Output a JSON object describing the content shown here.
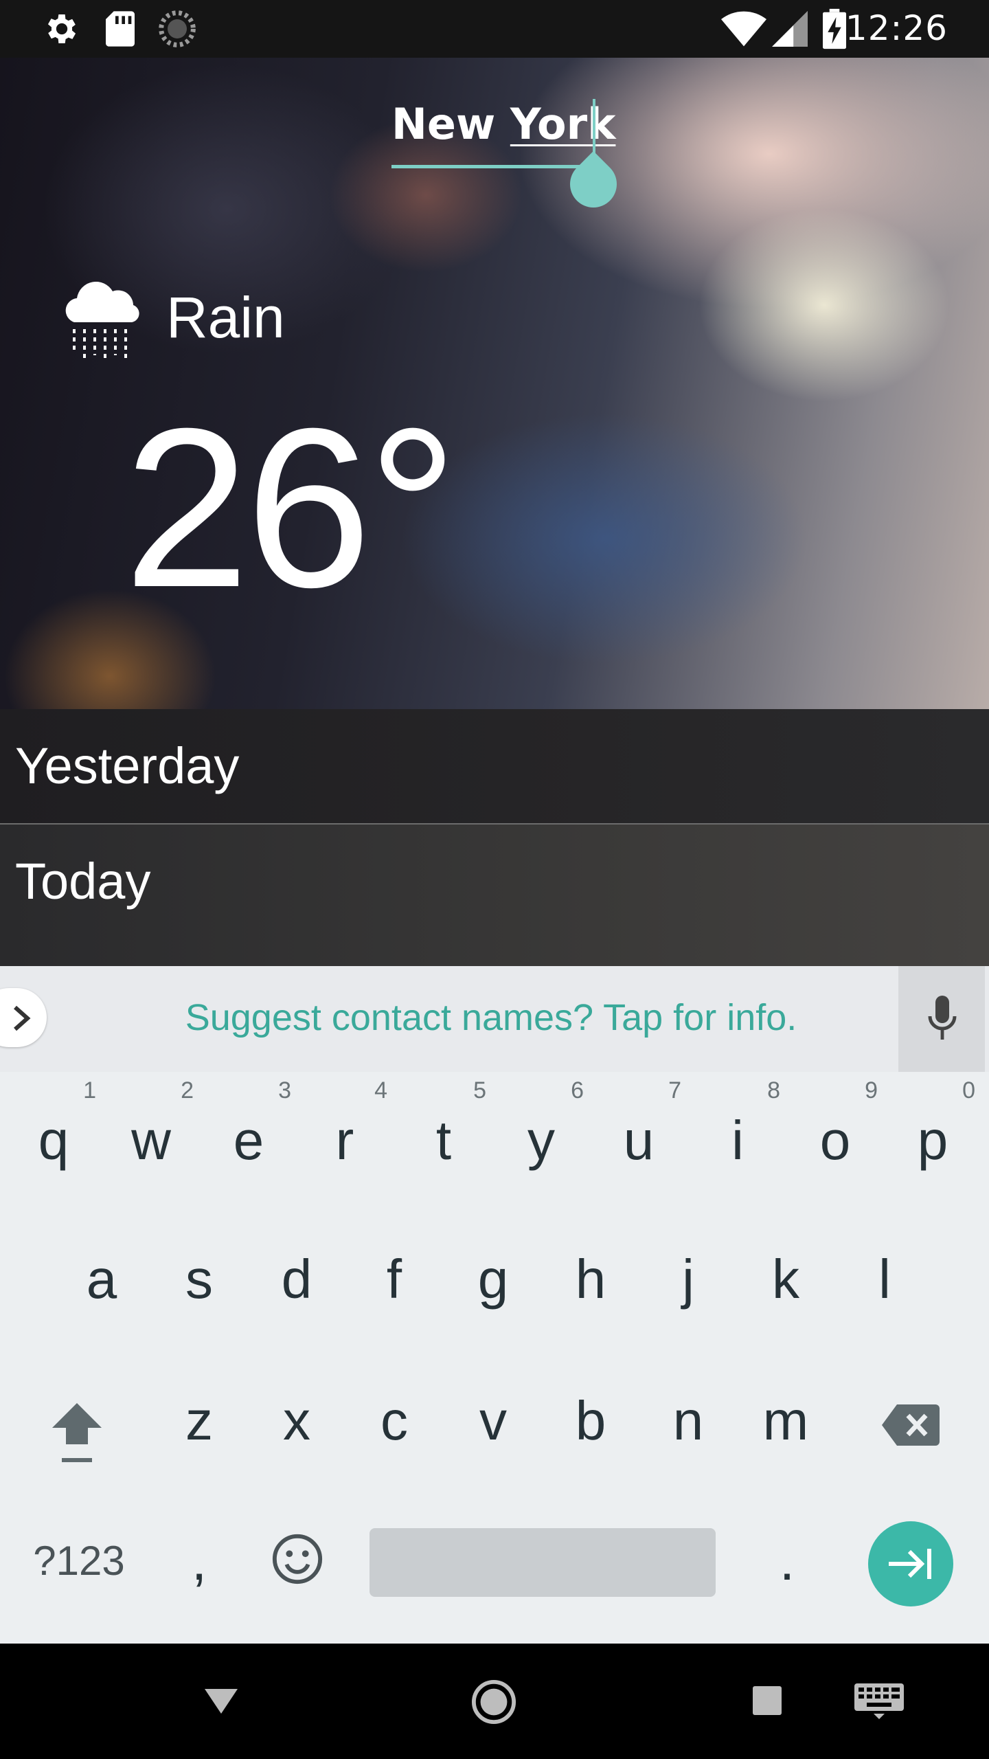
{
  "status_bar": {
    "time": "12:26",
    "left_icons": [
      "settings-icon",
      "sd-card-icon",
      "sync-icon"
    ],
    "right_icons": [
      "wifi-icon",
      "cell-signal-icon",
      "battery-charging-icon"
    ]
  },
  "weather": {
    "city_word_1": "New",
    "city_word_2": "York",
    "condition": "Rain",
    "condition_icon": "rain-cloud-icon",
    "temperature": "26°",
    "accent_color": "#7ecfc6"
  },
  "list": {
    "yesterday": "Yesterday",
    "today": "Today"
  },
  "suggestion": {
    "text": "Suggest contact names? Tap for info.",
    "text_color": "#3aa99a"
  },
  "keyboard": {
    "row1": [
      "q",
      "w",
      "e",
      "r",
      "t",
      "y",
      "u",
      "i",
      "o",
      "p"
    ],
    "row1_hints": [
      "1",
      "2",
      "3",
      "4",
      "5",
      "6",
      "7",
      "8",
      "9",
      "0"
    ],
    "row2": [
      "a",
      "s",
      "d",
      "f",
      "g",
      "h",
      "j",
      "k",
      "l"
    ],
    "row3": [
      "z",
      "x",
      "c",
      "v",
      "b",
      "n",
      "m"
    ],
    "symbols_label": "?123",
    "comma": ",",
    "period": ".",
    "enter_color": "#3cb8a8"
  },
  "nav_bar": {
    "icons": [
      "back-icon",
      "home-icon",
      "recents-icon",
      "keyboard-switch-icon"
    ]
  }
}
